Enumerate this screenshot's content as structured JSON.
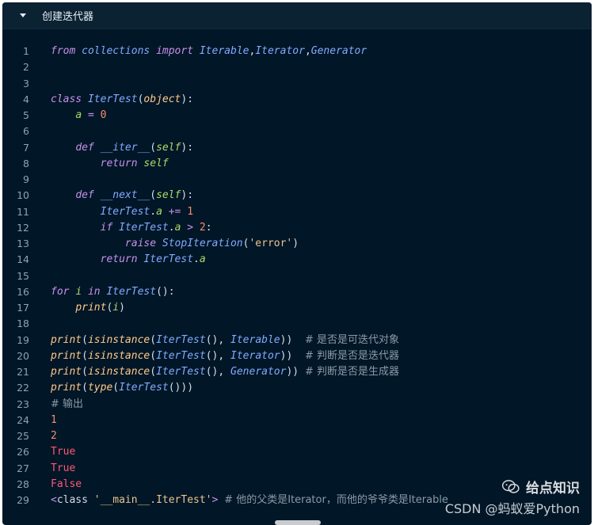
{
  "header": {
    "title": "创建迭代器",
    "toggle_icon": "caret-down-icon"
  },
  "code_lines": [
    {
      "n": "1",
      "tokens": [
        [
          "kw",
          "from"
        ],
        [
          "plain",
          " "
        ],
        [
          "ident",
          "collections"
        ],
        [
          "plain",
          " "
        ],
        [
          "kw",
          "import"
        ],
        [
          "plain",
          " "
        ],
        [
          "ident",
          "Iterable"
        ],
        [
          "punc",
          ","
        ],
        [
          "ident",
          "Iterator"
        ],
        [
          "punc",
          ","
        ],
        [
          "ident",
          "Generator"
        ]
      ]
    },
    {
      "n": "2",
      "tokens": []
    },
    {
      "n": "3",
      "tokens": []
    },
    {
      "n": "4",
      "tokens": [
        [
          "kw",
          "class"
        ],
        [
          "plain",
          " "
        ],
        [
          "ident",
          "IterTest"
        ],
        [
          "punc",
          "("
        ],
        [
          "obj",
          "object"
        ],
        [
          "punc",
          "):"
        ]
      ]
    },
    {
      "n": "5",
      "tokens": [
        [
          "plain",
          "    "
        ],
        [
          "var",
          "a"
        ],
        [
          "plain",
          " "
        ],
        [
          "op",
          "="
        ],
        [
          "plain",
          " "
        ],
        [
          "num",
          "0"
        ]
      ]
    },
    {
      "n": "6",
      "tokens": []
    },
    {
      "n": "7",
      "tokens": [
        [
          "plain",
          "    "
        ],
        [
          "kw",
          "def"
        ],
        [
          "plain",
          " "
        ],
        [
          "fn",
          "__iter__"
        ],
        [
          "punc",
          "("
        ],
        [
          "var",
          "self"
        ],
        [
          "punc",
          "):"
        ]
      ]
    },
    {
      "n": "8",
      "tokens": [
        [
          "plain",
          "        "
        ],
        [
          "kw",
          "return"
        ],
        [
          "plain",
          " "
        ],
        [
          "var",
          "self"
        ]
      ]
    },
    {
      "n": "9",
      "tokens": []
    },
    {
      "n": "10",
      "tokens": [
        [
          "plain",
          "    "
        ],
        [
          "kw",
          "def"
        ],
        [
          "plain",
          " "
        ],
        [
          "fn",
          "__next__"
        ],
        [
          "punc",
          "("
        ],
        [
          "var",
          "self"
        ],
        [
          "punc",
          "):"
        ]
      ]
    },
    {
      "n": "11",
      "tokens": [
        [
          "plain",
          "        "
        ],
        [
          "ident",
          "IterTest"
        ],
        [
          "punc",
          "."
        ],
        [
          "var",
          "a"
        ],
        [
          "plain",
          " "
        ],
        [
          "op",
          "+="
        ],
        [
          "plain",
          " "
        ],
        [
          "num",
          "1"
        ]
      ]
    },
    {
      "n": "12",
      "tokens": [
        [
          "plain",
          "        "
        ],
        [
          "kw",
          "if"
        ],
        [
          "plain",
          " "
        ],
        [
          "ident",
          "IterTest"
        ],
        [
          "punc",
          "."
        ],
        [
          "var",
          "a"
        ],
        [
          "plain",
          " "
        ],
        [
          "op",
          ">"
        ],
        [
          "plain",
          " "
        ],
        [
          "num",
          "2"
        ],
        [
          "punc",
          ":"
        ]
      ]
    },
    {
      "n": "13",
      "tokens": [
        [
          "plain",
          "            "
        ],
        [
          "kw",
          "raise"
        ],
        [
          "plain",
          " "
        ],
        [
          "ident",
          "StopIteration"
        ],
        [
          "punc",
          "("
        ],
        [
          "str",
          "'error'"
        ],
        [
          "punc",
          ")"
        ]
      ]
    },
    {
      "n": "14",
      "tokens": [
        [
          "plain",
          "        "
        ],
        [
          "kw",
          "return"
        ],
        [
          "plain",
          " "
        ],
        [
          "ident",
          "IterTest"
        ],
        [
          "punc",
          "."
        ],
        [
          "var",
          "a"
        ]
      ]
    },
    {
      "n": "15",
      "tokens": []
    },
    {
      "n": "16",
      "tokens": [
        [
          "kw",
          "for"
        ],
        [
          "plain",
          " "
        ],
        [
          "var",
          "i"
        ],
        [
          "plain",
          " "
        ],
        [
          "kw",
          "in"
        ],
        [
          "plain",
          " "
        ],
        [
          "ident",
          "IterTest"
        ],
        [
          "punc",
          "():"
        ]
      ]
    },
    {
      "n": "17",
      "tokens": [
        [
          "plain",
          "    "
        ],
        [
          "builtin",
          "print"
        ],
        [
          "punc",
          "("
        ],
        [
          "var",
          "i"
        ],
        [
          "punc",
          ")"
        ]
      ]
    },
    {
      "n": "18",
      "tokens": []
    },
    {
      "n": "19",
      "tokens": [
        [
          "builtin",
          "print"
        ],
        [
          "punc",
          "("
        ],
        [
          "builtin",
          "isinstance"
        ],
        [
          "punc",
          "("
        ],
        [
          "ident",
          "IterTest"
        ],
        [
          "punc",
          "(), "
        ],
        [
          "ident",
          "Iterable"
        ],
        [
          "punc",
          "))"
        ],
        [
          "plain",
          "  "
        ],
        [
          "cm",
          "# 是否是可迭代对象"
        ]
      ]
    },
    {
      "n": "20",
      "tokens": [
        [
          "builtin",
          "print"
        ],
        [
          "punc",
          "("
        ],
        [
          "builtin",
          "isinstance"
        ],
        [
          "punc",
          "("
        ],
        [
          "ident",
          "IterTest"
        ],
        [
          "punc",
          "(), "
        ],
        [
          "ident",
          "Iterator"
        ],
        [
          "punc",
          "))"
        ],
        [
          "plain",
          "  "
        ],
        [
          "cm",
          "# 判断是否是迭代器"
        ]
      ]
    },
    {
      "n": "21",
      "tokens": [
        [
          "builtin",
          "print"
        ],
        [
          "punc",
          "("
        ],
        [
          "builtin",
          "isinstance"
        ],
        [
          "punc",
          "("
        ],
        [
          "ident",
          "IterTest"
        ],
        [
          "punc",
          "(), "
        ],
        [
          "ident",
          "Generator"
        ],
        [
          "punc",
          "))"
        ],
        [
          "plain",
          " "
        ],
        [
          "cm",
          "# 判断是否是生成器"
        ]
      ]
    },
    {
      "n": "22",
      "tokens": [
        [
          "builtin",
          "print"
        ],
        [
          "punc",
          "("
        ],
        [
          "builtin",
          "type"
        ],
        [
          "punc",
          "("
        ],
        [
          "ident",
          "IterTest"
        ],
        [
          "punc",
          "()))"
        ]
      ]
    },
    {
      "n": "23",
      "tokens": [
        [
          "cm",
          "# 输出"
        ]
      ]
    },
    {
      "n": "24",
      "tokens": [
        [
          "num",
          "1"
        ]
      ]
    },
    {
      "n": "25",
      "tokens": [
        [
          "num",
          "2"
        ]
      ]
    },
    {
      "n": "26",
      "tokens": [
        [
          "true",
          "True"
        ]
      ]
    },
    {
      "n": "27",
      "tokens": [
        [
          "true",
          "True"
        ]
      ]
    },
    {
      "n": "28",
      "tokens": [
        [
          "true",
          "False"
        ]
      ]
    },
    {
      "n": "29",
      "tokens": [
        [
          "op",
          "<"
        ],
        [
          "cls",
          "class"
        ],
        [
          "plain",
          " "
        ],
        [
          "str",
          "'__main__.IterTest'"
        ],
        [
          "op",
          ">"
        ],
        [
          "plain",
          " "
        ],
        [
          "cm",
          "# 他的父类是Iterator，而他的爷爷类是Iterable"
        ]
      ]
    }
  ],
  "watermark": {
    "brand": "给点知识",
    "icon": "wechat-icon",
    "credit": "CSDN @蚂蚁爱Python"
  },
  "colors": {
    "background": "#011627",
    "keyword": "#c792ea",
    "identifier": "#82aaff",
    "variable": "#addb67",
    "number": "#f78c6c",
    "string": "#ecc48d",
    "builtin": "#ffcb8b",
    "comment": "#8a9aa8"
  }
}
